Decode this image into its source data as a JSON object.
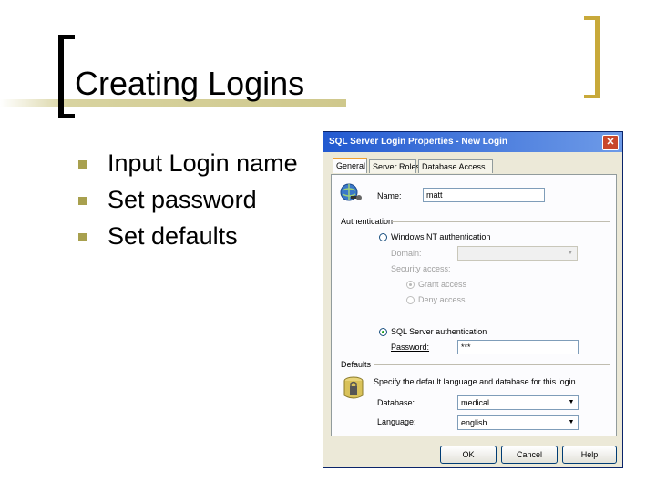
{
  "slide": {
    "title": "Creating Logins",
    "bullets": [
      "Input Login name",
      "Set password",
      "Set defaults"
    ]
  },
  "dialog": {
    "title": "SQL Server Login Properties - New Login",
    "close_glyph": "✕",
    "tabs": [
      "General",
      "Server Roles",
      "Database Access"
    ],
    "name_label": "Name:",
    "name_value": "matt",
    "authentication_label": "Authentication",
    "windows_auth_label": "Windows NT authentication",
    "domain_label": "Domain:",
    "domain_value": "",
    "security_access_label": "Security access:",
    "grant_access_label": "Grant access",
    "deny_access_label": "Deny access",
    "sql_auth_label": "SQL Server authentication",
    "password_label": "Password:",
    "password_value": "***",
    "defaults_label": "Defaults",
    "defaults_description": "Specify the default language and database for this login.",
    "database_label": "Database:",
    "database_value": "medical",
    "language_label": "Language:",
    "language_value": "english",
    "dropdown_glyph": "▼",
    "ok_label": "OK",
    "cancel_label": "Cancel",
    "help_label": "Help"
  },
  "colors": {
    "titlebar": "#2259d0",
    "bullet": "#a8a04e",
    "accent_bar": "#cfc88c"
  },
  "icons": [
    "login-globe-key-icon",
    "defaults-database-icon"
  ]
}
